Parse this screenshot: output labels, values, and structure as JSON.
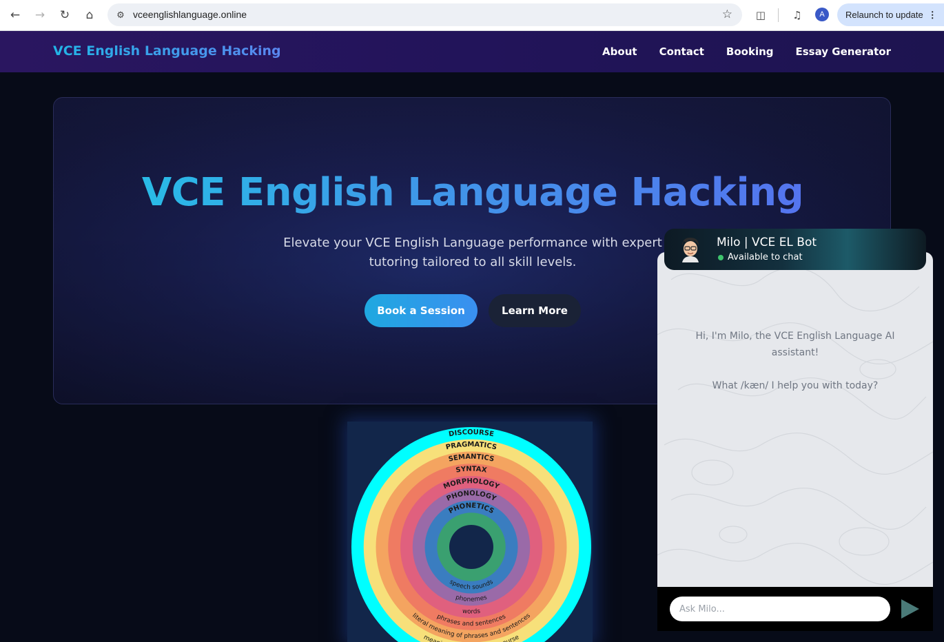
{
  "browser": {
    "url": "vceenglishlanguage.online",
    "relaunch_label": "Relaunch to update",
    "profile_initial": "A",
    "icons": [
      "back-icon",
      "forward-icon",
      "reload-icon",
      "home-icon",
      "site-info-icon",
      "bookmark-star-icon",
      "extensions-icon",
      "media-control-icon",
      "more-menu-icon"
    ]
  },
  "nav": {
    "brand": "VCE English Language Hacking",
    "links": [
      "About",
      "Contact",
      "Booking",
      "Essay Generator"
    ]
  },
  "hero": {
    "title": "VCE English Language Hacking",
    "subtitle": "Elevate your VCE English Language performance with expert tutoring tailored to all skill levels.",
    "primary_button": "Book a Session",
    "secondary_button": "Learn More"
  },
  "diagram": {
    "rings": [
      {
        "label": "DISCOURSE",
        "color": "#00ffff"
      },
      {
        "label": "PRAGMATICS",
        "color": "#f7e07a"
      },
      {
        "label": "SEMANTICS",
        "color": "#f4a460"
      },
      {
        "label": "SYNTAX",
        "color": "#ef7b62"
      },
      {
        "label": "MORPHOLOGY",
        "color": "#e0607e"
      },
      {
        "label": "PHONOLOGY",
        "color": "#9a6aa8"
      },
      {
        "label": "PHONETICS",
        "color": "#3a7dc0"
      },
      {
        "label": "",
        "color": "#3aa070"
      }
    ],
    "inner_labels": [
      "speech sounds",
      "phonemes",
      "words",
      "phrases and sentences",
      "literal meaning of phrases and sentences",
      "meaning in context of discourse"
    ],
    "center_color": "#12264a"
  },
  "chat": {
    "bot_name": "Milo | VCE EL Bot",
    "status": "Available to chat",
    "greeting": "Hi, I'm Milo, the VCE English Language AI assistant!",
    "question": "What /kæn/ I help you with today?",
    "input_placeholder": "Ask Milo...",
    "status_color": "#3ec46d"
  }
}
